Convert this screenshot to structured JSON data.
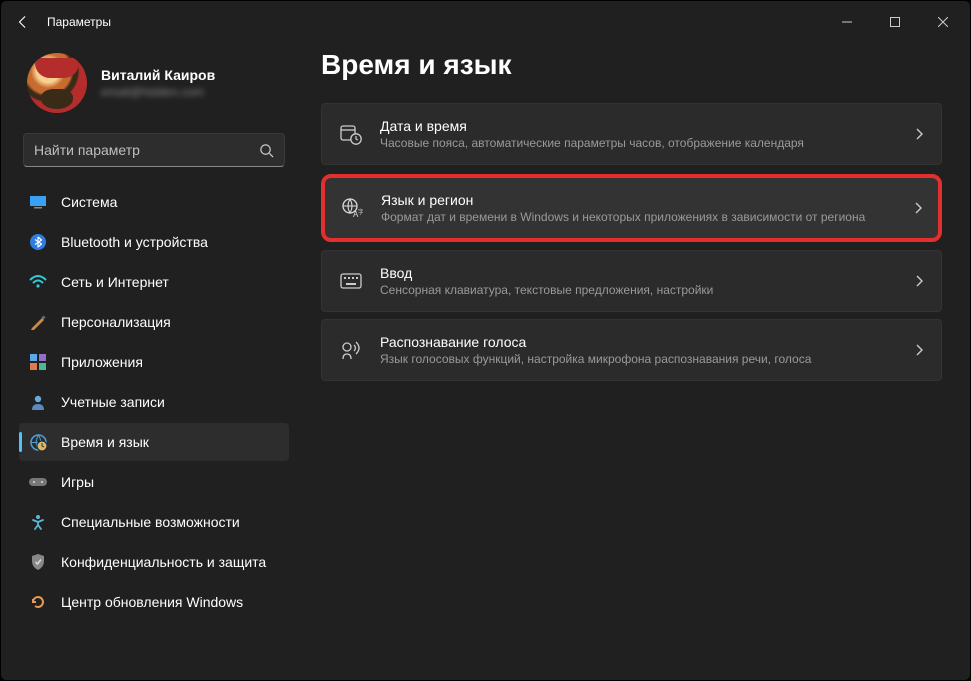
{
  "window": {
    "title": "Параметры"
  },
  "profile": {
    "name": "Виталий Каиров",
    "email": "email@hidden.com"
  },
  "search": {
    "placeholder": "Найти параметр"
  },
  "sidebar": {
    "items": [
      {
        "label": "Система",
        "icon": "system"
      },
      {
        "label": "Bluetooth и устройства",
        "icon": "bluetooth"
      },
      {
        "label": "Сеть и Интернет",
        "icon": "network"
      },
      {
        "label": "Персонализация",
        "icon": "personalization"
      },
      {
        "label": "Приложения",
        "icon": "apps"
      },
      {
        "label": "Учетные записи",
        "icon": "accounts"
      },
      {
        "label": "Время и язык",
        "icon": "time-language",
        "active": true
      },
      {
        "label": "Игры",
        "icon": "gaming"
      },
      {
        "label": "Специальные возможности",
        "icon": "accessibility"
      },
      {
        "label": "Конфиденциальность и защита",
        "icon": "privacy"
      },
      {
        "label": "Центр обновления Windows",
        "icon": "update"
      }
    ]
  },
  "main": {
    "title": "Время и язык",
    "cards": [
      {
        "title": "Дата и время",
        "desc": "Часовые пояса, автоматические параметры часов, отображение календаря"
      },
      {
        "title": "Язык и регион",
        "desc": "Формат дат и времени в Windows и некоторых приложениях в зависимости от региона",
        "highlight": true
      },
      {
        "title": "Ввод",
        "desc": "Сенсорная клавиатура, текстовые предложения, настройки"
      },
      {
        "title": "Распознавание голоса",
        "desc": "Язык голосовых функций, настройка микрофона распознавания речи, голоса"
      }
    ]
  }
}
